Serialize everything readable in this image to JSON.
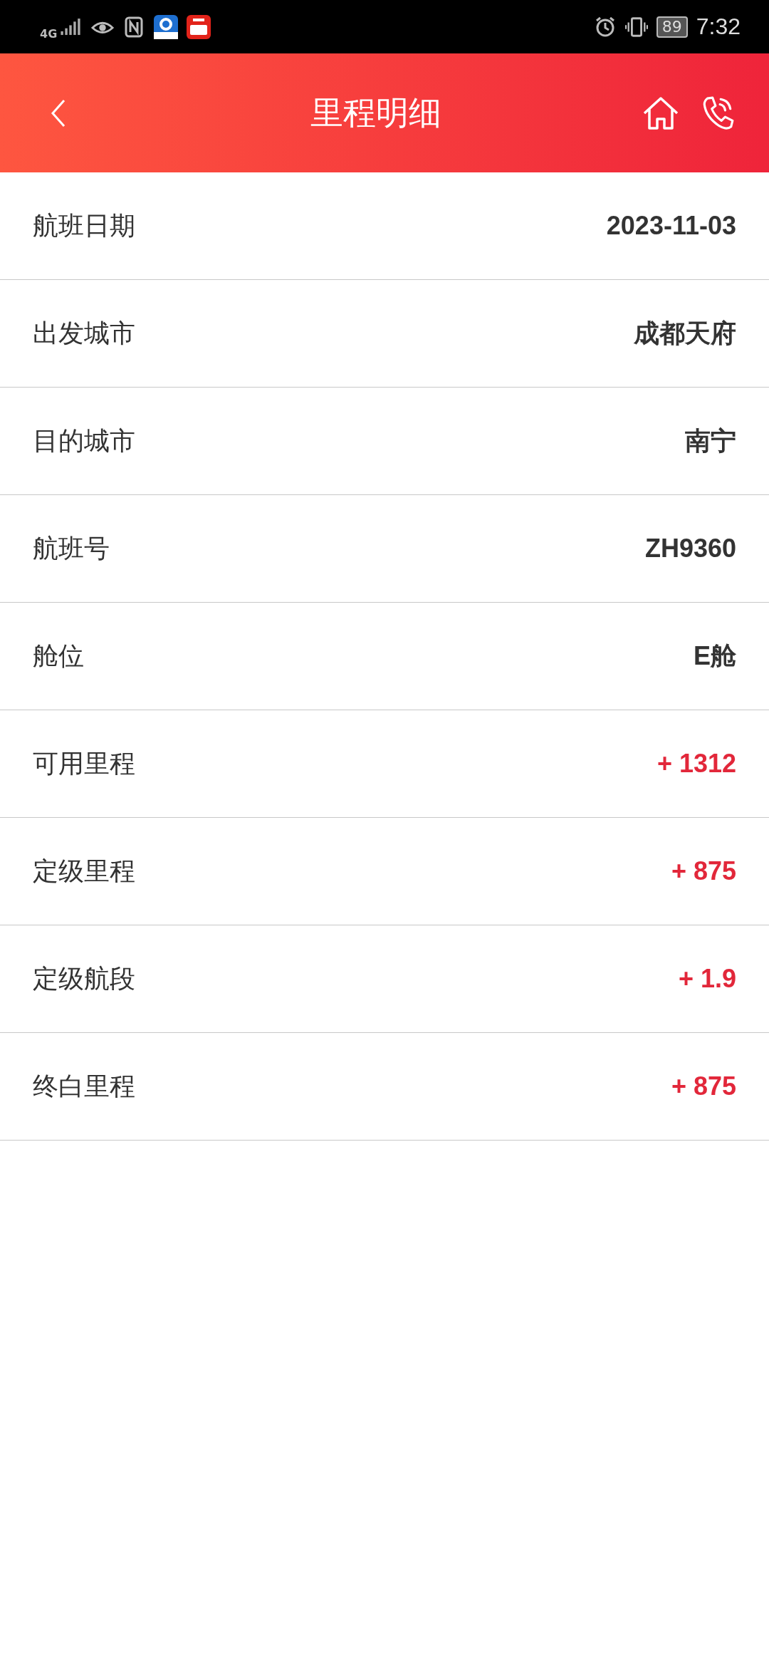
{
  "status_bar": {
    "network": "4G",
    "battery": "89",
    "time": "7:32"
  },
  "header": {
    "title": "里程明细"
  },
  "rows": [
    {
      "label": "航班日期",
      "value": "2023-11-03",
      "kind": "plain"
    },
    {
      "label": "出发城市",
      "value": "成都天府",
      "kind": "plain"
    },
    {
      "label": "目的城市",
      "value": "南宁",
      "kind": "plain"
    },
    {
      "label": "航班号",
      "value": "ZH9360",
      "kind": "plain"
    },
    {
      "label": "舱位",
      "value": "E舱",
      "kind": "plain"
    },
    {
      "label": "可用里程",
      "value": "+ 1312",
      "kind": "credit"
    },
    {
      "label": "定级里程",
      "value": "+ 875",
      "kind": "credit"
    },
    {
      "label": "定级航段",
      "value": "+ 1.9",
      "kind": "credit"
    },
    {
      "label": "终白里程",
      "value": "+ 875",
      "kind": "credit"
    }
  ]
}
